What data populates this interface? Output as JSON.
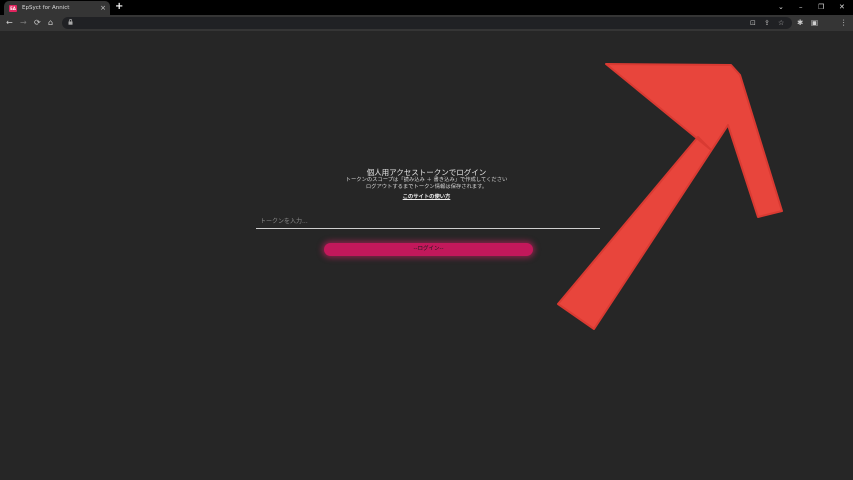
{
  "browser": {
    "tab": {
      "favicon_text": "EA",
      "title": "EpSyct for Annict",
      "close_glyph": "×"
    },
    "new_tab_glyph": "+",
    "window_controls": {
      "list": "⌄",
      "minimize": "–",
      "restore": "❐",
      "close": "✕"
    },
    "toolbar": {
      "back": "←",
      "forward": "→",
      "reload": "⟳",
      "home": "⌂",
      "lock": "🔒",
      "install_icon": "⊡",
      "share_icon": "⇪",
      "star_icon": "☆",
      "extensions_icon": "✱",
      "sidepanel_icon": "▣",
      "menu_icon": "⋮"
    }
  },
  "login": {
    "title": "個人用アクセストークンでログイン",
    "desc_line1": "トークンのスコープは「読み込み ＋ 書き込み」で作成してください",
    "desc_line2": "ログアウトするまでトークン情報は保存されます。",
    "howto_link": "このサイトの使い方",
    "input_placeholder": "トークンを入力...",
    "input_value": "",
    "button_label": "--ログイン--"
  },
  "annotation": {
    "type": "arrow",
    "color": "#e8453c",
    "direction": "up-right"
  }
}
